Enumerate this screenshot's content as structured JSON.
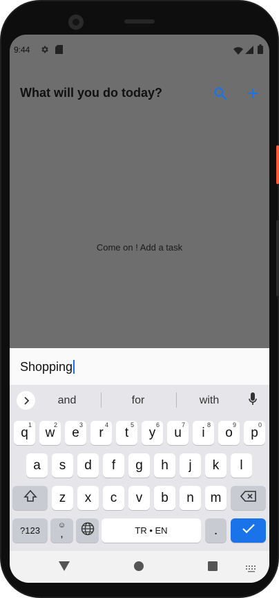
{
  "status_bar": {
    "time": "9:44",
    "left_icons": [
      "gear-icon",
      "sd-card-icon"
    ],
    "right_icons": [
      "wifi-icon",
      "signal-icon",
      "battery-icon"
    ]
  },
  "app_bar": {
    "title": "What will you do today?",
    "actions": [
      "search-icon",
      "add-icon"
    ],
    "accent_color": "#1a73e8"
  },
  "empty_state": {
    "message": "Come on ! Add a task"
  },
  "task_input": {
    "value": "Shopping"
  },
  "keyboard": {
    "suggestions": [
      "and",
      "for",
      "with"
    ],
    "row1": [
      {
        "key": "q",
        "hint": "1"
      },
      {
        "key": "w",
        "hint": "2"
      },
      {
        "key": "e",
        "hint": "3"
      },
      {
        "key": "r",
        "hint": "4"
      },
      {
        "key": "t",
        "hint": "5"
      },
      {
        "key": "y",
        "hint": "6"
      },
      {
        "key": "u",
        "hint": "7"
      },
      {
        "key": "i",
        "hint": "8"
      },
      {
        "key": "o",
        "hint": "9"
      },
      {
        "key": "p",
        "hint": "0"
      }
    ],
    "row2": [
      "a",
      "s",
      "d",
      "f",
      "g",
      "h",
      "j",
      "k",
      "l"
    ],
    "row3": [
      "z",
      "x",
      "c",
      "v",
      "b",
      "n",
      "m"
    ],
    "symbols_label": "?123",
    "comma_label": ",",
    "space_label": "TR • EN",
    "period_label": "."
  },
  "nav_bar": {
    "buttons": [
      "back-icon",
      "home-icon",
      "recents-icon",
      "keyboard-switch-icon"
    ]
  }
}
